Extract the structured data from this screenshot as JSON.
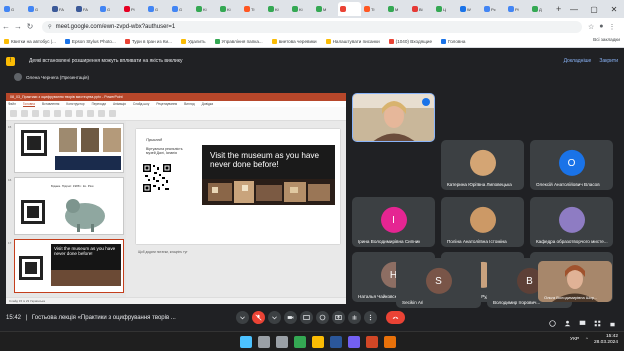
{
  "browser": {
    "tabs": [
      {
        "label": "G",
        "color": "#4285f4"
      },
      {
        "label": "G",
        "color": "#4285f4"
      },
      {
        "label": "FA",
        "color": "#3b5998"
      },
      {
        "label": "FA",
        "color": "#3b5998"
      },
      {
        "label": "G",
        "color": "#4285f4"
      },
      {
        "label": "Pi",
        "color": "#e60023"
      },
      {
        "label": "G",
        "color": "#4285f4"
      },
      {
        "label": "G",
        "color": "#4285f4"
      },
      {
        "label": "Ki",
        "color": "#34a853"
      },
      {
        "label": "Ki",
        "color": "#34a853"
      },
      {
        "label": "Tł",
        "color": "#ff5722"
      },
      {
        "label": "Kł",
        "color": "#34a853"
      },
      {
        "label": "Ki",
        "color": "#34a853"
      },
      {
        "label": "M",
        "color": "#34a853"
      },
      {
        "label": "",
        "color": "#ea4335",
        "active": true
      },
      {
        "label": "Tł",
        "color": "#ff5722"
      },
      {
        "label": "M",
        "color": "#34a853"
      },
      {
        "label": "Bi",
        "color": "#e53935"
      },
      {
        "label": "Ц",
        "color": "#34a853"
      },
      {
        "label": "W",
        "color": "#1a73e8"
      },
      {
        "label": "Pc",
        "color": "#4285f4"
      },
      {
        "label": "Pł",
        "color": "#4285f4"
      },
      {
        "label": "Д",
        "color": "#34a853"
      }
    ],
    "new_tab": "+",
    "window_controls": {
      "minimize": "—",
      "maximize": "▢",
      "close": "✕"
    },
    "url": "meet.google.com/ewn-zvpd-wbx?authuser=1",
    "bookmarks": [
      {
        "label": "Квитки на автобус |...",
        "color": "#fbbc04"
      },
      {
        "label": "Epson Stylus Photo...",
        "color": "#1a73e8"
      },
      {
        "label": "Тури в Іран из Ки...",
        "color": "#ea4335"
      },
      {
        "label": "Удалить",
        "color": "#fbbc04"
      },
      {
        "label": "Управління папка...",
        "color": "#34a853"
      },
      {
        "label": "виетова черевики",
        "color": "#fbbc04"
      },
      {
        "label": "Налаштувати писанки",
        "color": "#fbbc04"
      },
      {
        "label": "(1040) Входящие",
        "color": "#ea4335"
      },
      {
        "label": "Головна",
        "color": "#1a73e8"
      }
    ],
    "bookmarks_right": "Всі закладки"
  },
  "meet": {
    "extension_notice": "Деякі встановлені розширення можуть впливати на якість виклику",
    "extension_details": "Докладніше",
    "extension_close": "Закрити",
    "presenter_label": "Олена Чернега (Презентація)",
    "presentation": {
      "app_title": "08_03_Практики з оцифрування творів мистецтва.pptx - PowerPoint",
      "ribbon_tabs": [
        "Файл",
        "Головна",
        "Вставлення",
        "Конструктор",
        "Переходи",
        "Анімація",
        "Слайд-шоу",
        "Рецензування",
        "Вигляд",
        "Довідка"
      ],
      "slide_kicker": "Приклад",
      "slide_subtitle": "Віртуальна реальність музей Далі, Іспанія",
      "slide_photo_text": "Visit the museum as you have never done before!",
      "notes": "Щоб додати нотатки, клацніть тут",
      "statusbar": "Слайд 15 із 23   Українська",
      "thumbnails": [
        {
          "num": "15",
          "caption": ""
        },
        {
          "num": "16",
          "caption": "Бідака. Підпис: 1988 г. Ко. Ріки"
        },
        {
          "num": "17",
          "caption": "Visit the museum as you have never done before!"
        }
      ]
    },
    "participants": [
      {
        "name": "Олена Чернега",
        "initial": "",
        "color": "#a98c6e",
        "photo": true
      },
      {
        "name": "",
        "initial": "",
        "color": "#c5a27b",
        "photo": true
      },
      {
        "name": "Катерина Юріївна Липовецька",
        "initial": "",
        "color": "#d4a574",
        "photo": true
      },
      {
        "name": "Олексій Анатолійович Власов",
        "initial": "O",
        "color": "#1a73e8"
      },
      {
        "name": "Ірина Володимирівна Сипник",
        "initial": "I",
        "color": "#e52592"
      },
      {
        "name": "Поліна Анатоліївна Істоміна",
        "initial": "",
        "color": "#cc9966",
        "photo": true
      },
      {
        "name": "Кафедра образотворчого мисте...",
        "initial": "",
        "color": "#8e7cc3",
        "photo": true
      },
      {
        "name": "Наталья Чайковская",
        "initial": "H",
        "color": "#8d6e63"
      },
      {
        "name": "Алла Андріївна Руденченко",
        "initial": "",
        "color": "#c9a27e",
        "photo": true
      },
      {
        "name": "Вероніка Іванівна Зайцева",
        "initial": "",
        "color": "#d9b58c",
        "photo": true
      },
      {
        "name": "Secikin Ari",
        "initial": "S",
        "color": "#795548"
      },
      {
        "name": "Володимир Ігорович...",
        "initial": "B",
        "color": "#5d4037"
      },
      {
        "name": "Ольга Володимирівна Шир...",
        "initial": "",
        "color": "#b58863",
        "photo": true
      }
    ],
    "bottom": {
      "time": "15:42",
      "meeting_title": "Гостьова лекція «Практики з оцифрування творів ..."
    }
  },
  "taskbar": {
    "language": "УКР",
    "time": "15:42",
    "date": "28.03.2024",
    "apps": [
      {
        "name": "windows",
        "color": "#4cc2ff"
      },
      {
        "name": "search",
        "color": "#9aa0a6"
      },
      {
        "name": "task-view",
        "color": "#9aa0a6"
      },
      {
        "name": "chrome",
        "color": "#34a853"
      },
      {
        "name": "explorer",
        "color": "#fbbc04"
      },
      {
        "name": "word",
        "color": "#2b579a"
      },
      {
        "name": "viber",
        "color": "#7360f2"
      },
      {
        "name": "powerpoint",
        "color": "#d24726"
      },
      {
        "name": "app",
        "color": "#e8710a"
      }
    ]
  }
}
